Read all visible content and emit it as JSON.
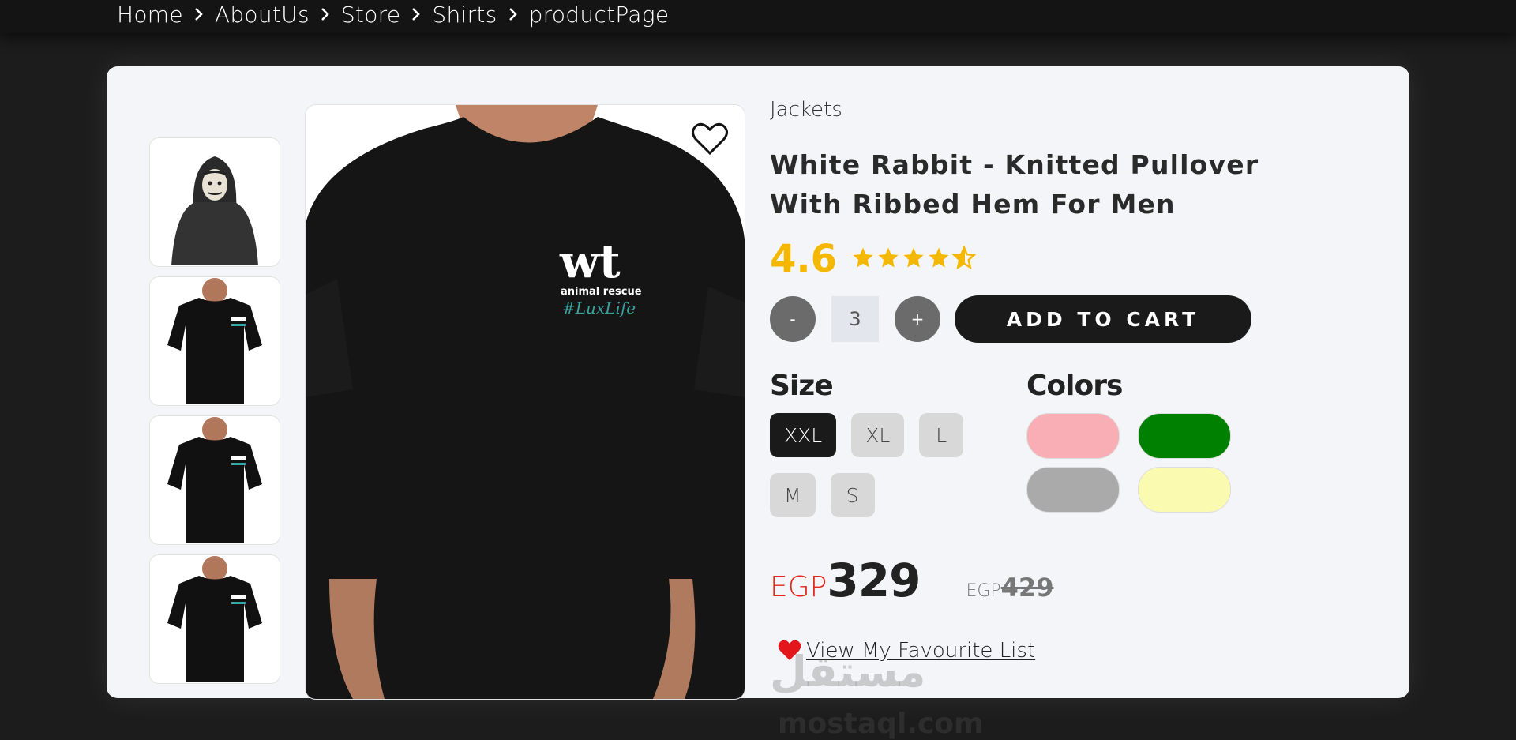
{
  "breadcrumb": [
    "Home",
    "AboutUs",
    "Store",
    "Shirts",
    "productPage"
  ],
  "product": {
    "category": "Jackets",
    "title": "White Rabbit - Knitted Pullover With Ribbed Hem For Men",
    "rating": "4.6",
    "stars_filled": 4.6,
    "stars_total": 5,
    "quantity": "3",
    "qty_minus": "-",
    "qty_plus": "+",
    "add_to_cart": "ADD TO CART",
    "print_logo": "wt",
    "print_sub": "animal rescue",
    "print_tag": "#LuxLife"
  },
  "sizes": {
    "title": "Size",
    "options": [
      "XXL",
      "XL",
      "L",
      "M",
      "S"
    ],
    "selected": "XXL"
  },
  "colors": {
    "title": "Colors",
    "swatches": [
      "#f8aeb4",
      "#008000",
      "#aaaaaa",
      "#fafab0"
    ]
  },
  "price": {
    "currency": "EGP",
    "current": "329",
    "old_currency": "EGP",
    "old": "429"
  },
  "favourite_link": "View My Favourite List",
  "watermark": {
    "text": "مستقل",
    "sub": "mostaql.com"
  },
  "icons": {
    "breadcrumb_sep": "chevron-right-icon",
    "wishlist": "heart-outline-icon",
    "favourite": "heart-filled-icon",
    "rating": "star-icon"
  },
  "theme": {
    "accent_star": "#f5b800",
    "price_currency": "#e3271c",
    "button_dark": "#1a1a1a"
  }
}
